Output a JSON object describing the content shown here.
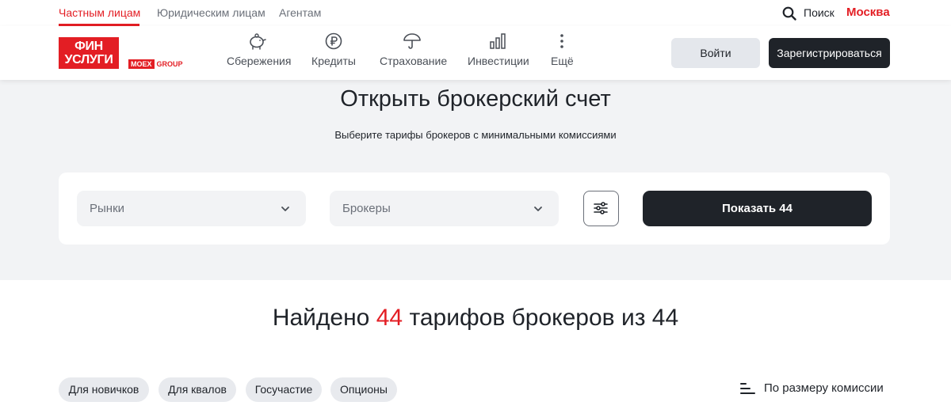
{
  "top_nav": {
    "segments": [
      "Частным лицам",
      "Юридическим лицам",
      "Агентам"
    ],
    "search_label": "Поиск",
    "city": "Москва"
  },
  "header": {
    "logo_line1": "ФИН",
    "logo_line2": "УСЛУГИ",
    "logo_partner_a": "MOEX",
    "logo_partner_b": "GROUP",
    "nav": [
      {
        "label": "Сбережения",
        "icon": "piggy-bank-icon"
      },
      {
        "label": "Кредиты",
        "icon": "ruble-icon"
      },
      {
        "label": "Страхование",
        "icon": "umbrella-icon"
      },
      {
        "label": "Инвестиции",
        "icon": "bar-chart-icon"
      },
      {
        "label": "Ещё",
        "icon": "more-vertical-icon"
      }
    ],
    "login_label": "Войти",
    "register_label": "Зарегистрироваться"
  },
  "hero": {
    "title": "Открыть брокерский счет",
    "subtitle": "Выберите тарифы брокеров с минимальными комиссиями",
    "filters": {
      "markets_placeholder": "Рынки",
      "brokers_placeholder": "Брокеры",
      "show_button": "Показать 44"
    }
  },
  "results": {
    "title_prefix": "Найдено",
    "count": "44",
    "title_suffix": "тарифов брокеров из 44",
    "chips": [
      "Для новичков",
      "Для квалов",
      "Госучастие",
      "Опционы"
    ],
    "sort_label": "По размеру комиссии"
  },
  "colors": {
    "brand_red": "#e31e24",
    "dark": "#1f2329",
    "hero_bg": "#f2f3f5"
  }
}
